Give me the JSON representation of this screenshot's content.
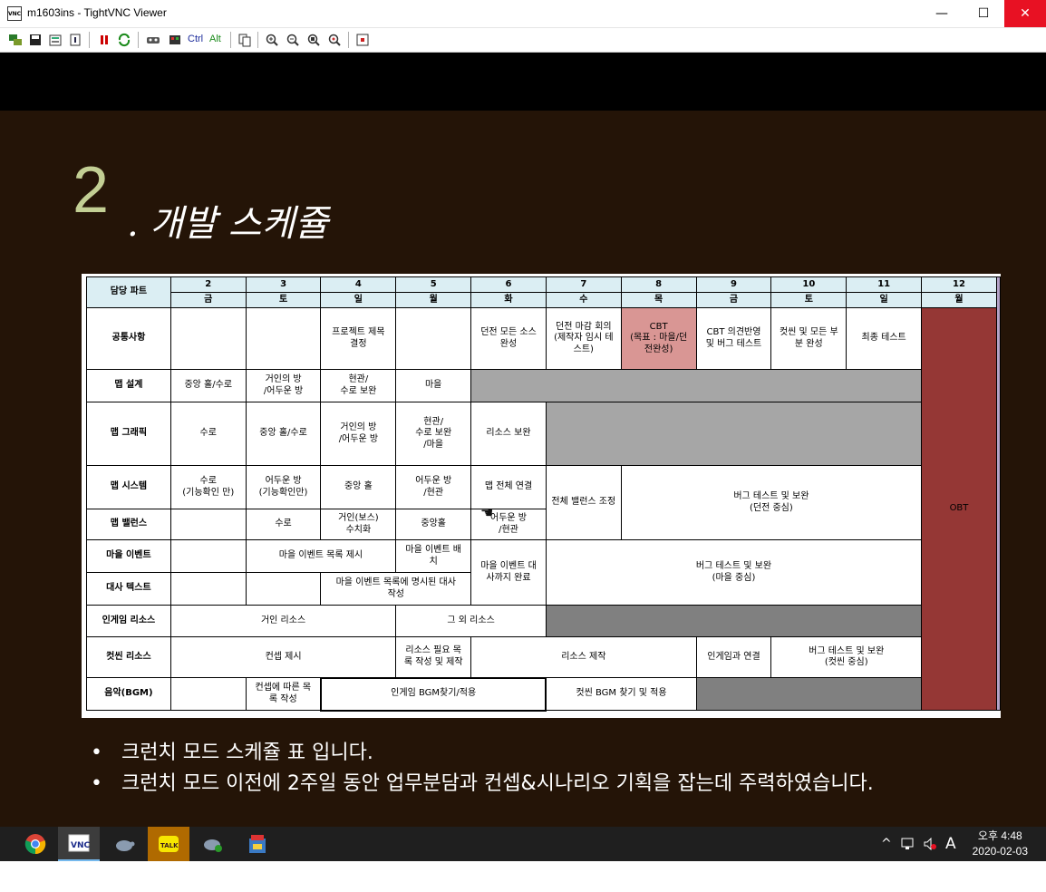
{
  "window": {
    "title": "m1603ins - TightVNC Viewer",
    "icon_label": "VNC",
    "controls": {
      "minimize": "—",
      "maximize": "☐",
      "close": "✕"
    }
  },
  "toolbar": {
    "ctrl_label": "Ctrl",
    "alt_label": "Alt"
  },
  "slide": {
    "number": "2",
    "title_suffix": ". 개발 스케쥴",
    "bullets": [
      "크런치 모드 스케쥴 표 입니다.",
      "크런치 모드 이전에 2주일 동안 업무분담과 컨셉&시나리오 기획을 잡는데 주력하였습니다."
    ]
  },
  "schedule": {
    "corner": "담당 파트",
    "dates": [
      "2",
      "3",
      "4",
      "5",
      "6",
      "7",
      "8",
      "9",
      "10",
      "11",
      "12"
    ],
    "weekdays": [
      "금",
      "토",
      "일",
      "월",
      "화",
      "수",
      "목",
      "금",
      "토",
      "일",
      "월"
    ],
    "rows": {
      "common": {
        "label": "공통사항",
        "c4": "프로젝트 제목\n결정",
        "c6": "던전 모든 소스\n완성",
        "c7": "던전 마감 회의\n(제작자 임시 테\n스트)",
        "c8": "CBT\n(목표 : 마을/던\n전완성)",
        "c9": "CBT 의견반영\n및 버그 테스트",
        "c10": "컷씬 및 모든 부\n분 완성",
        "c11": "최종 테스트",
        "obt": "OBT"
      },
      "map_design": {
        "label": "맵 설계",
        "c2": "중앙 홀/수로",
        "c3": "거인의 방\n/어두운 방",
        "c4": "현관/\n수로 보완",
        "c5": "마을"
      },
      "map_graphic": {
        "label": "맵 그래픽",
        "c2": "수로",
        "c3": "중앙 홀/수로",
        "c4": "거인의 방\n/어두운 방",
        "c5": "현관/\n수로 보완\n/마을",
        "c6": "리소스 보완"
      },
      "map_system": {
        "label": "맵 시스템",
        "c2": "수로\n(기능확인 만)",
        "c3": "어두운 방\n(기능확인만)",
        "c4": "중앙 홀",
        "c5": "어두운 방\n/현관",
        "c6": "맵 전체 연결",
        "c7": "전체 밸런스 조정",
        "c8_11": "버그 테스트 및 보완\n(던전 중심)"
      },
      "map_balance": {
        "label": "맵 밸런스",
        "c3": "수로",
        "c4": "거인(보스)\n수치화",
        "c5": "중앙홀",
        "c6": "어두운 방\n/현관"
      },
      "village_event": {
        "label": "마을 이벤트",
        "c3_4": "마을 이벤트 목록 제시",
        "c5": "마을 이벤트 배\n치",
        "c6": "마을 이벤트 대\n사까지 완료",
        "c7_11": "버그 테스트 및 보완\n(마을 중심)"
      },
      "dialogue": {
        "label": "대사 텍스트",
        "c4_5": "마을 이벤트 목록에 명시된 대사\n작성"
      },
      "ingame_res": {
        "label": "인게임 리소스",
        "c2_4": "거인 리소스",
        "c5_6": "그 외 리소스"
      },
      "cutscene_res": {
        "label": "컷씬 리소스",
        "c2_4": "컨셉 제시",
        "c5": "리소스 필요 목\n록 작성 및 제작",
        "c6_8": "리소스 제작",
        "c9": "인게임과 연결",
        "c10_11": "버그 테스트 및 보완\n(컷씬 중심)"
      },
      "music": {
        "label": "음악(BGM)",
        "c3": "컨셉에 따른 목\n록 작성",
        "c4_6": "인게임 BGM찾기/적용",
        "c7_8": "컷씬 BGM 찾기 및 적용"
      }
    }
  },
  "taskbar": {
    "ime": "A",
    "time": "오후 4:48",
    "date": "2020-02-03",
    "talk_label": "TALK"
  },
  "colors": {
    "slide_bg": "#241407",
    "header_bg": "#dbeef3",
    "cbt": "#d99694",
    "obt": "#953735",
    "number": "#c3cf94"
  }
}
